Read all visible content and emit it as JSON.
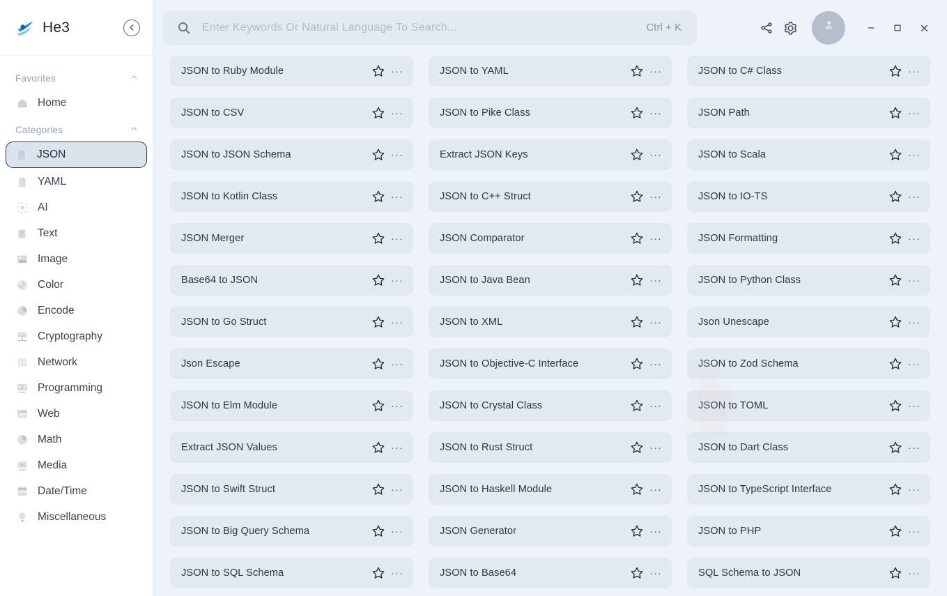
{
  "app": {
    "brand_name": "He3",
    "logo_icon": "he3-logo-icon",
    "collapse_icon": "chevron-left-circle-icon"
  },
  "search": {
    "placeholder": "Enter Keywords Or Natural Language To Search...",
    "value": "",
    "shortcut": "Ctrl + K",
    "icon": "search-icon"
  },
  "titlebar": {
    "share_icon": "share-icon",
    "settings_icon": "gear-icon",
    "avatar_icon": "user-avatar-icon",
    "minimize_label": "–",
    "maximize_label": "□",
    "close_label": "✕"
  },
  "sidebar": {
    "groups": [
      {
        "label": "Favorites",
        "caret_icon": "chevron-up-icon",
        "items": [
          {
            "label": "Home",
            "icon": "home-icon",
            "selected": false
          }
        ]
      },
      {
        "label": "Categories",
        "caret_icon": "chevron-up-icon",
        "items": [
          {
            "label": "JSON",
            "icon": "file-json-icon",
            "selected": true
          },
          {
            "label": "YAML",
            "icon": "file-yaml-icon",
            "selected": false
          },
          {
            "label": "AI",
            "icon": "ai-sparkle-icon",
            "selected": false
          },
          {
            "label": "Text",
            "icon": "text-icon",
            "selected": false
          },
          {
            "label": "Image",
            "icon": "image-icon",
            "selected": false
          },
          {
            "label": "Color",
            "icon": "color-palette-icon",
            "selected": false
          },
          {
            "label": "Encode",
            "icon": "encode-icon",
            "selected": false
          },
          {
            "label": "Cryptography",
            "icon": "cryptography-icon",
            "selected": false
          },
          {
            "label": "Network",
            "icon": "network-icon",
            "selected": false
          },
          {
            "label": "Programming",
            "icon": "programming-icon",
            "selected": false
          },
          {
            "label": "Web",
            "icon": "web-icon",
            "selected": false
          },
          {
            "label": "Math",
            "icon": "math-icon",
            "selected": false
          },
          {
            "label": "Media",
            "icon": "media-icon",
            "selected": false
          },
          {
            "label": "Date/Time",
            "icon": "calendar-icon",
            "selected": false
          },
          {
            "label": "Miscellaneous",
            "icon": "lightbulb-icon",
            "selected": false
          }
        ]
      }
    ]
  },
  "tools": {
    "star_icon": "star-outline-icon",
    "more_icon": "more-horizontal-icon",
    "more_glyph": "···",
    "cards": [
      "JSON to Ruby Module",
      "JSON to YAML",
      "JSON to C# Class",
      "JSON to CSV",
      "JSON to Pike Class",
      "JSON Path",
      "JSON to JSON Schema",
      "Extract JSON Keys",
      "JSON to Scala",
      "JSON to Kotlin Class",
      "JSON to C++ Struct",
      "JSON to IO-TS",
      "JSON Merger",
      "JSON Comparator",
      "JSON Formatting",
      "Base64 to JSON",
      "JSON to Java Bean",
      "JSON to Python Class",
      "JSON to Go Struct",
      "JSON to XML",
      "Json Unescape",
      "Json Escape",
      "JSON to Objective-C Interface",
      "JSON to Zod Schema",
      "JSON to Elm Module",
      "JSON to Crystal Class",
      "JSON to TOML",
      "Extract JSON Values",
      "JSON to Rust Struct",
      "JSON to Dart Class",
      "JSON to Swift Struct",
      "JSON to Haskell Module",
      "JSON to TypeScript Interface",
      "JSON to Big Query Schema",
      "JSON Generator",
      "JSON to PHP",
      "JSON to SQL Schema",
      "JSON to Base64",
      "SQL Schema to JSON"
    ]
  },
  "colors": {
    "app_background": "#eef3fa",
    "sidebar_background": "#ffffff",
    "card_background": "#e3e9f1",
    "search_background": "#e4eaf2",
    "selected_item_background": "#dbe3ed",
    "brand_blue": "#2aa7e0",
    "text_primary": "#2d3543",
    "text_muted": "#9aa3b2"
  }
}
